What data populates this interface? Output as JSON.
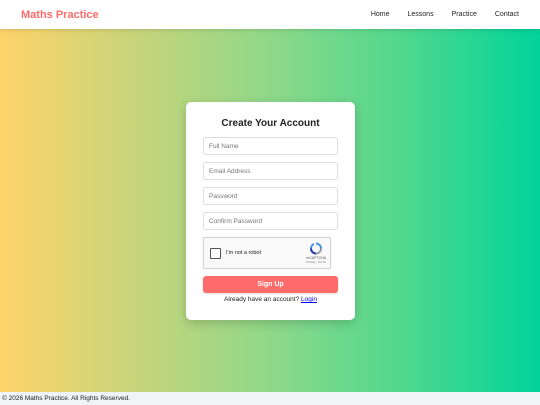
{
  "navbar": {
    "brand": "Maths Practice",
    "links": [
      "Home",
      "Lessons",
      "Practice",
      "Contact"
    ]
  },
  "form": {
    "title": "Create Your Account",
    "fields": {
      "full_name": {
        "placeholder": "Full Name",
        "value": ""
      },
      "email": {
        "placeholder": "Email Address",
        "value": ""
      },
      "password": {
        "placeholder": "Password",
        "value": ""
      },
      "confirm_password": {
        "placeholder": "Confirm Password",
        "value": ""
      }
    },
    "captcha": {
      "label": "I'm not a robot",
      "brand": "reCAPTCHA",
      "links": "Privacy - Terms",
      "checked": false
    },
    "submit_label": "Sign Up",
    "login_prompt": "Already have an account?",
    "login_link": "Login"
  },
  "footer": {
    "text": "© 2026 Maths Practice. All Rights Reserved."
  },
  "colors": {
    "brand": "#ff6b6b",
    "gradient_start": "#fed36a",
    "gradient_end": "#00d39a",
    "link": "#0000ee"
  },
  "icons": {
    "captcha": "recaptcha-icon"
  }
}
